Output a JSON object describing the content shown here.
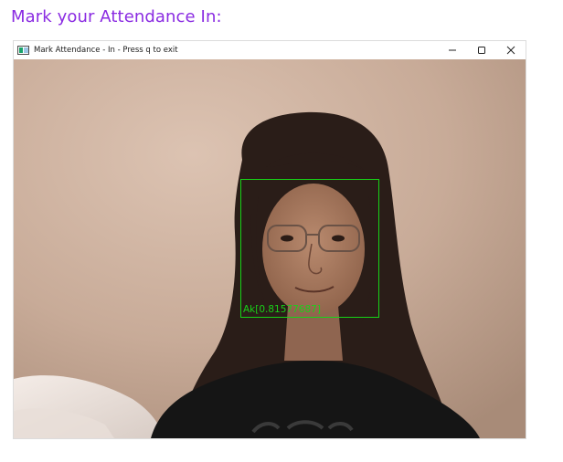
{
  "page": {
    "heading": "Mark your Attendance In:"
  },
  "window": {
    "title": "Mark Attendance - In - Press q to exit",
    "icon": "app-window-icon",
    "controls": {
      "minimize": "minimize-icon",
      "maximize": "maximize-icon",
      "close": "close-icon"
    }
  },
  "camera": {
    "recognition_label": "Ak[0.81577687]",
    "box_color": "#17d317"
  },
  "colors": {
    "heading": "#8a2be2"
  }
}
